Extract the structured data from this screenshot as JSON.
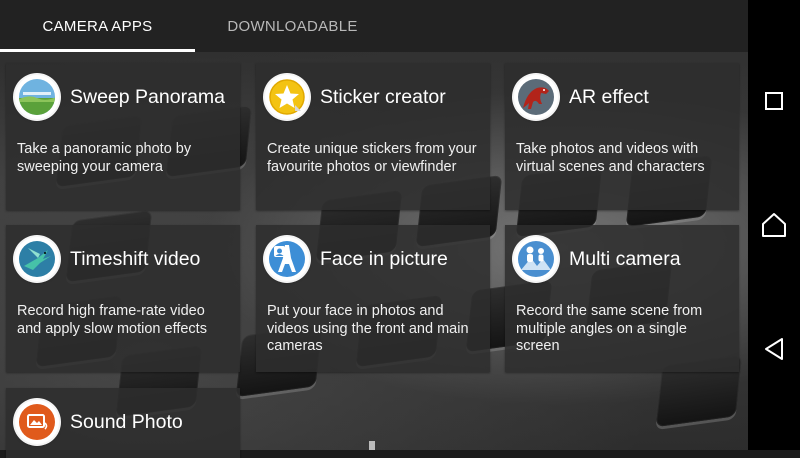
{
  "tabs": [
    {
      "label": "CAMERA APPS",
      "active": true
    },
    {
      "label": "DOWNLOADABLE",
      "active": false
    }
  ],
  "apps": [
    {
      "name": "Sweep Panorama",
      "description": "Take a panoramic photo by sweeping your camera",
      "icon": "panorama-icon"
    },
    {
      "name": "Sticker creator",
      "description": "Create unique stickers from your favourite photos or viewfinder",
      "icon": "star-sticker-icon"
    },
    {
      "name": "AR effect",
      "description": "Take photos and videos with virtual scenes and characters",
      "icon": "dinosaur-icon"
    },
    {
      "name": "Timeshift video",
      "description": "Record high frame-rate video and apply slow motion effects",
      "icon": "hummingbird-icon"
    },
    {
      "name": "Face in picture",
      "description": "Put your face in photos and videos using the front and main cameras",
      "icon": "face-eiffel-icon"
    },
    {
      "name": "Multi camera",
      "description": "Record the same scene from multiple angles on a single screen",
      "icon": "multi-camera-icon"
    },
    {
      "name": "Sound Photo",
      "description": "",
      "icon": "sound-photo-icon"
    }
  ],
  "navbar": {
    "buttons": [
      "recents-button",
      "home-button",
      "back-button"
    ]
  },
  "colors": {
    "tab_bar": "#222222",
    "card": "#2d2d2d",
    "navbar": "#000000",
    "sound_photo_icon": "#e05a1c"
  }
}
